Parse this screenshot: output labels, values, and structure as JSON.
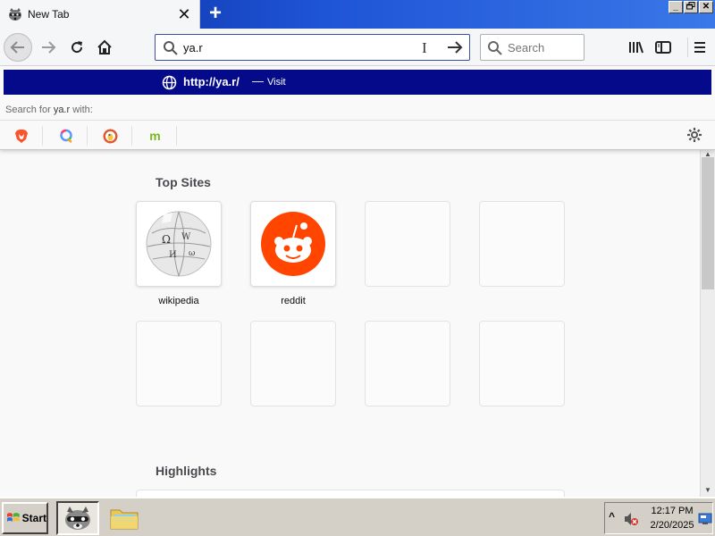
{
  "tab": {
    "title": "New Tab",
    "close_glyph": "✕",
    "favicon": "raccoon-favicon-icon"
  },
  "new_tab_glyph": "+",
  "window_controls": {
    "minimize": "_",
    "restore": "▫",
    "close": "✕"
  },
  "urlbar": {
    "value": "ya.r"
  },
  "searchbar": {
    "placeholder": "Search"
  },
  "popup": {
    "result_url": "http://ya.r/",
    "result_separator": "—",
    "result_action": "Visit",
    "search_with_prefix": "Search for ",
    "search_with_term": "ya.r",
    "search_with_suffix": " with:",
    "engines": [
      "brave-icon",
      "qwant-icon",
      "duckduckgo-icon",
      "mojeek-icon"
    ]
  },
  "newtab": {
    "top_sites_title": "Top Sites",
    "top_sites": [
      {
        "label": "wikipedia",
        "icon": "wikipedia-globe-icon"
      },
      {
        "label": "reddit",
        "icon": "reddit-icon"
      },
      {
        "label": ""
      },
      {
        "label": ""
      },
      {
        "label": ""
      },
      {
        "label": ""
      },
      {
        "label": ""
      },
      {
        "label": ""
      }
    ],
    "highlights_title": "Highlights"
  },
  "taskbar": {
    "start_label": "Start",
    "time": "12:17 PM",
    "date": "2/20/2025",
    "tray_expand": "^"
  },
  "colors": {
    "accent": "#050a8a",
    "titlebar": "#1e54d6",
    "reddit": "#ff4500"
  }
}
